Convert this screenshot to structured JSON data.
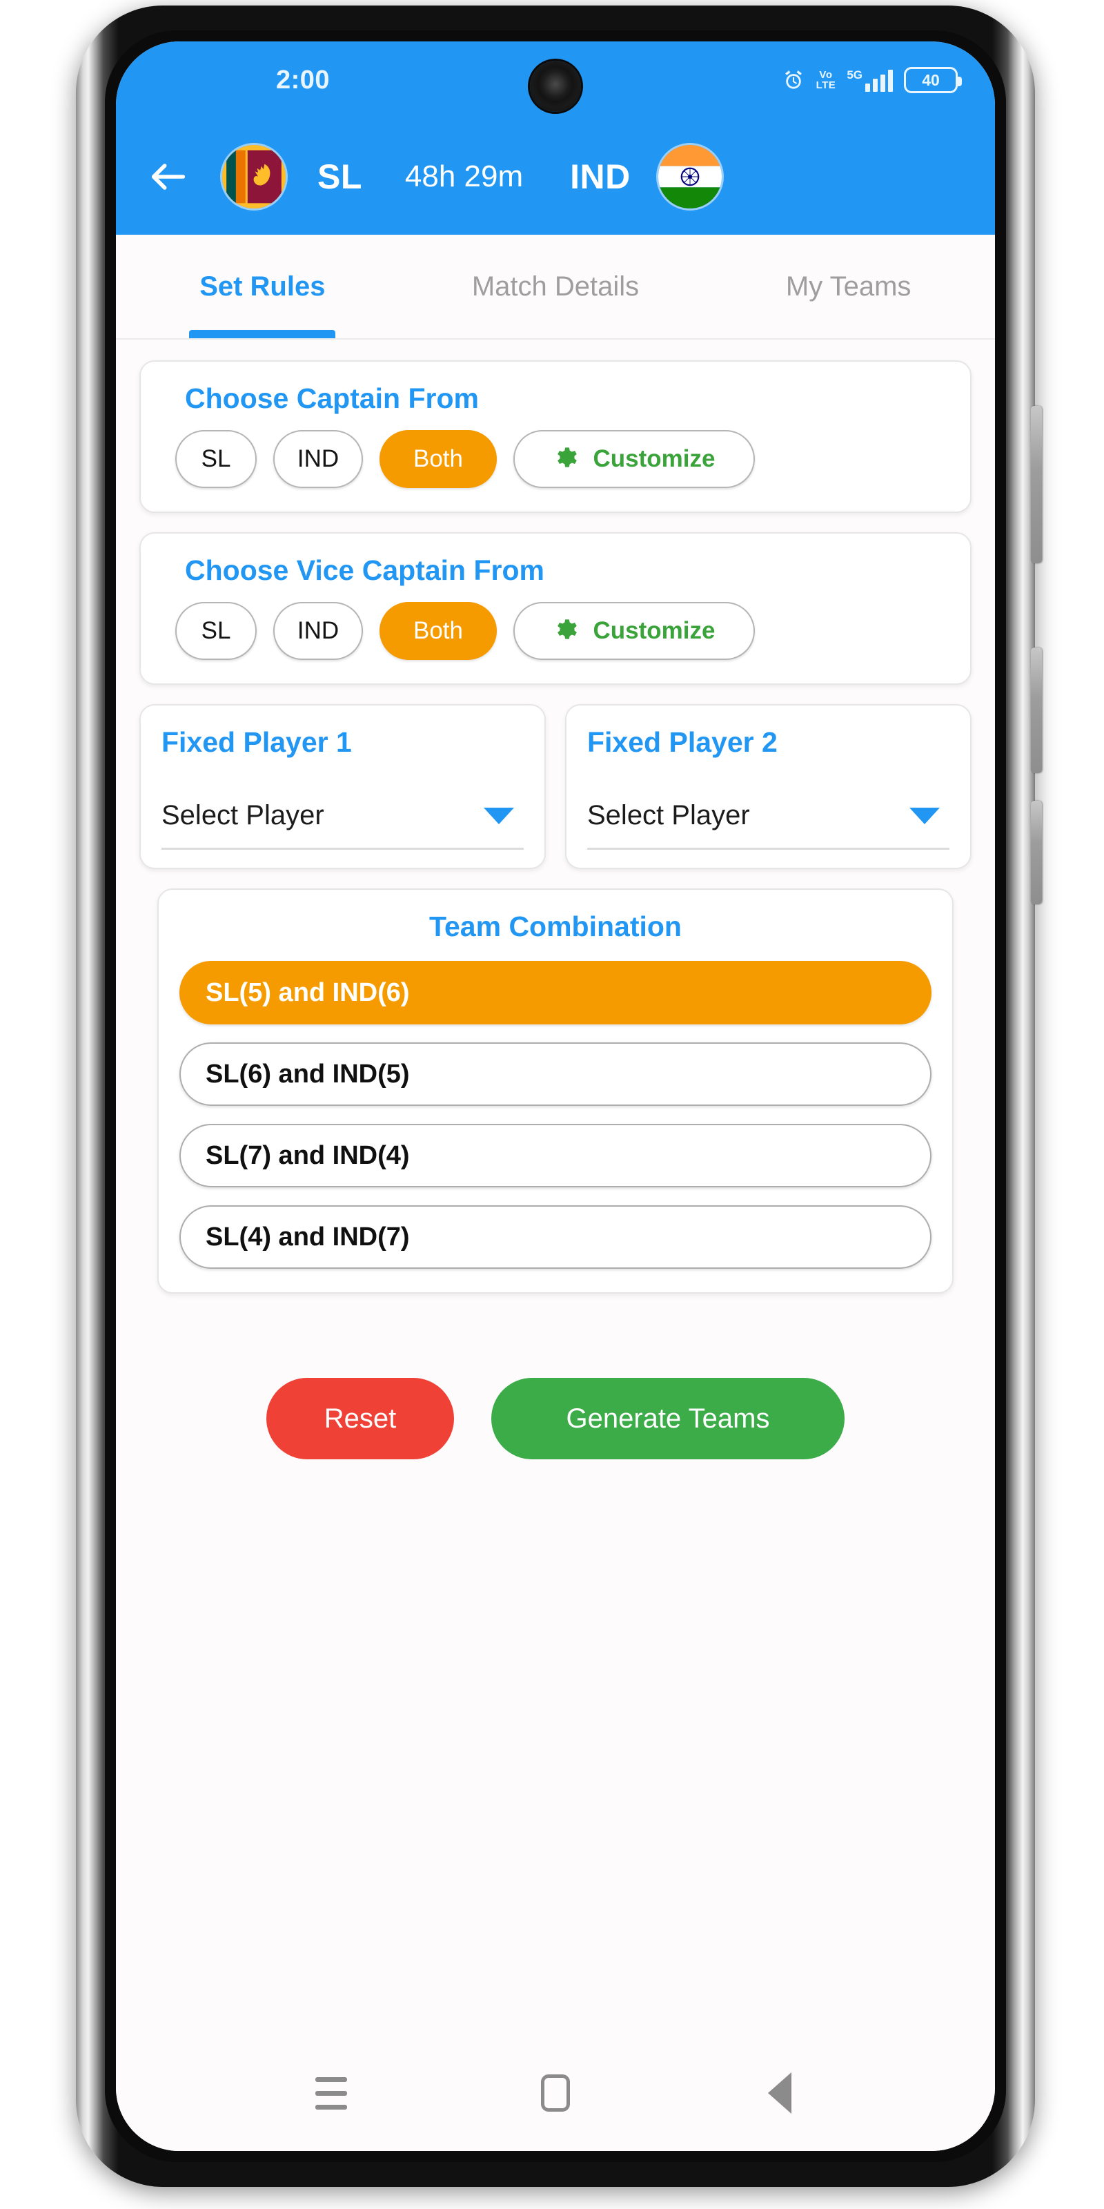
{
  "status_bar": {
    "time": "2:00",
    "alarm_icon": "alarm-clock-icon",
    "volte_top": "Vo",
    "volte_bottom": "LTE",
    "network": "5G",
    "battery_level": "40"
  },
  "app_bar": {
    "back_icon": "back-arrow-icon",
    "team_left": "SL",
    "team_left_flag": "sri-lanka-flag",
    "timer": "48h 29m",
    "team_right": "IND",
    "team_right_flag": "india-flag"
  },
  "tabs": [
    {
      "label": "Set Rules",
      "active": true
    },
    {
      "label": "Match Details",
      "active": false
    },
    {
      "label": "My Teams",
      "active": false
    }
  ],
  "captain": {
    "title": "Choose Captain From",
    "options": [
      "SL",
      "IND",
      "Both"
    ],
    "selected": "Both",
    "customize_label": "Customize",
    "customize_icon": "gear-icon"
  },
  "vice_captain": {
    "title": "Choose Vice Captain From",
    "options": [
      "SL",
      "IND",
      "Both"
    ],
    "selected": "Both",
    "customize_label": "Customize",
    "customize_icon": "gear-icon"
  },
  "fixed_players": [
    {
      "title": "Fixed Player 1",
      "value": "Select Player",
      "caret_icon": "chevron-down-icon"
    },
    {
      "title": "Fixed Player 2",
      "value": "Select Player",
      "caret_icon": "chevron-down-icon"
    }
  ],
  "team_combination": {
    "title": "Team Combination",
    "options": [
      {
        "label": "SL(5) and IND(6)",
        "selected": true
      },
      {
        "label": "SL(6) and IND(5)",
        "selected": false
      },
      {
        "label": "SL(7) and IND(4)",
        "selected": false
      },
      {
        "label": "SL(4) and IND(7)",
        "selected": false
      }
    ]
  },
  "actions": {
    "reset_label": "Reset",
    "generate_label": "Generate Teams"
  },
  "nav_bar": {
    "recents_icon": "recents-icon",
    "home_icon": "home-icon",
    "back_icon": "back-triangle-icon"
  },
  "colors": {
    "primary_blue": "#2196f3",
    "accent_orange": "#f59b00",
    "green": "#3bac48",
    "customize_green": "#3aa33a",
    "red": "#ef4136",
    "muted_text": "#9e9e9e"
  }
}
